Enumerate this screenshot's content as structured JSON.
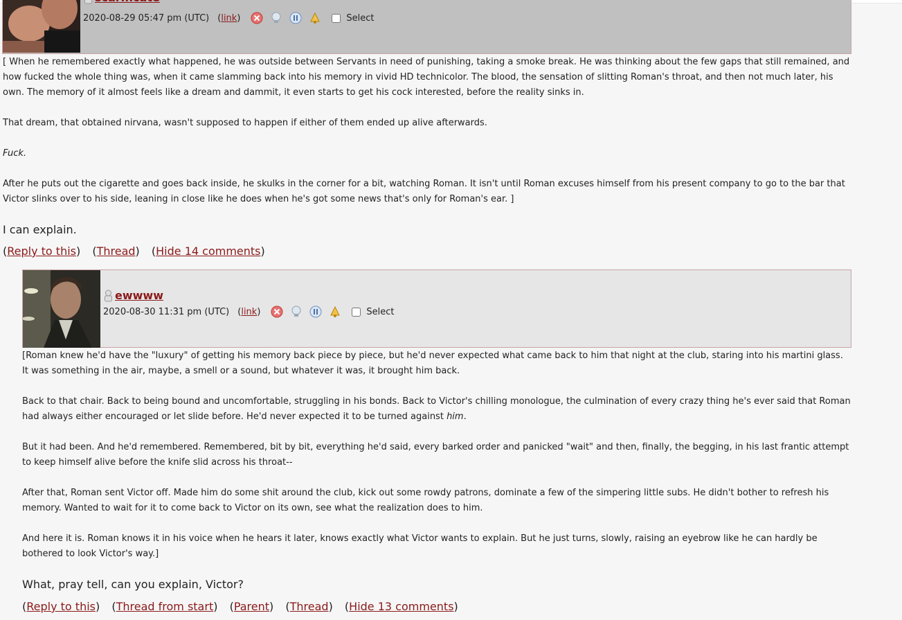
{
  "comment1": {
    "username": "scarificate",
    "timestamp": "2020-08-29 05:47 pm (UTC)",
    "link_label": "link",
    "select_label": "Select",
    "body": [
      "[ When he remembered exactly what happened, he was outside between Servants in need of punishing, taking a smoke break. He was thinking about the few gaps that still remained, and how fucked the whole thing was, when it came slamming back into his memory in vivid HD technicolor. The blood, the sensation of slitting Roman's throat, and then not much later, his own. The memory of it almost feels like a dream and dammit, it even starts to get his cock interested, before the reality sinks in.",
      "That dream, that obtained nirvana, wasn't supposed to happen if either of them ended up alive afterwards.",
      "Fuck.",
      "After he puts out the cigarette and goes back inside, he skulks in the corner for a bit, watching Roman. It isn't until Roman excuses himself from his present company to go to the bar that Victor slinks over to his side, leaning in close like he does when he's got some news that's only for Roman's ear. ]"
    ],
    "subject": "I can explain.",
    "links": {
      "reply": "Reply to this",
      "thread": "Thread",
      "hide": "Hide 14 comments"
    }
  },
  "comment2": {
    "username": "ewwww",
    "timestamp": "2020-08-30 11:31 pm (UTC)",
    "link_label": "link",
    "select_label": "Select",
    "body": [
      "[Roman knew he'd have the \"luxury\" of getting his memory back piece by piece, but he'd never expected what came back to him that night at the club, staring into his martini glass. It was something in the air, maybe, a smell or a sound, but whatever it was, it brought him back.",
      "Back to that chair. Back to being bound and uncomfortable, struggling in his bonds. Back to Victor's chilling monologue, the culmination of every crazy thing he's ever said that Roman had always either encouraged or let slide before. He'd never expected it to be turned against ",
      "him",
      ".",
      "But it had been. And he'd remembered. Remembered, bit by bit, everything he'd said, every barked order and panicked \"wait\" and then, finally, the begging, in his last frantic attempt to keep himself alive before the knife slid across his throat--",
      "After that, Roman sent Victor off. Made him do some shit around the club, kick out some rowdy patrons, dominate a few of the simpering little subs. He didn't bother to refresh his memory. Wanted to wait for it to come back to Victor on its own, see what the realization does to him.",
      "And here it is. Roman knows it in his voice when he hears it later, knows exactly what Victor wants to explain. But he just turns, slowly, raising an eyebrow like he can hardly be bothered to look Victor's way.]"
    ],
    "subject": "What, pray tell, can you explain, Victor?",
    "links": {
      "reply": "Reply to this",
      "thread_start": "Thread from start",
      "parent": "Parent",
      "thread": "Thread",
      "hide": "Hide 13 comments"
    }
  },
  "colors": {
    "link": "#8b1a1a",
    "header1_bg": "#c0c0c0",
    "header2_bg": "#e6e6e6",
    "header_border": "#c9a3a3",
    "page_bg": "#f6f6f6"
  },
  "icons": [
    "user-icon",
    "delete-icon",
    "screen-icon",
    "freeze-icon",
    "track-icon"
  ]
}
